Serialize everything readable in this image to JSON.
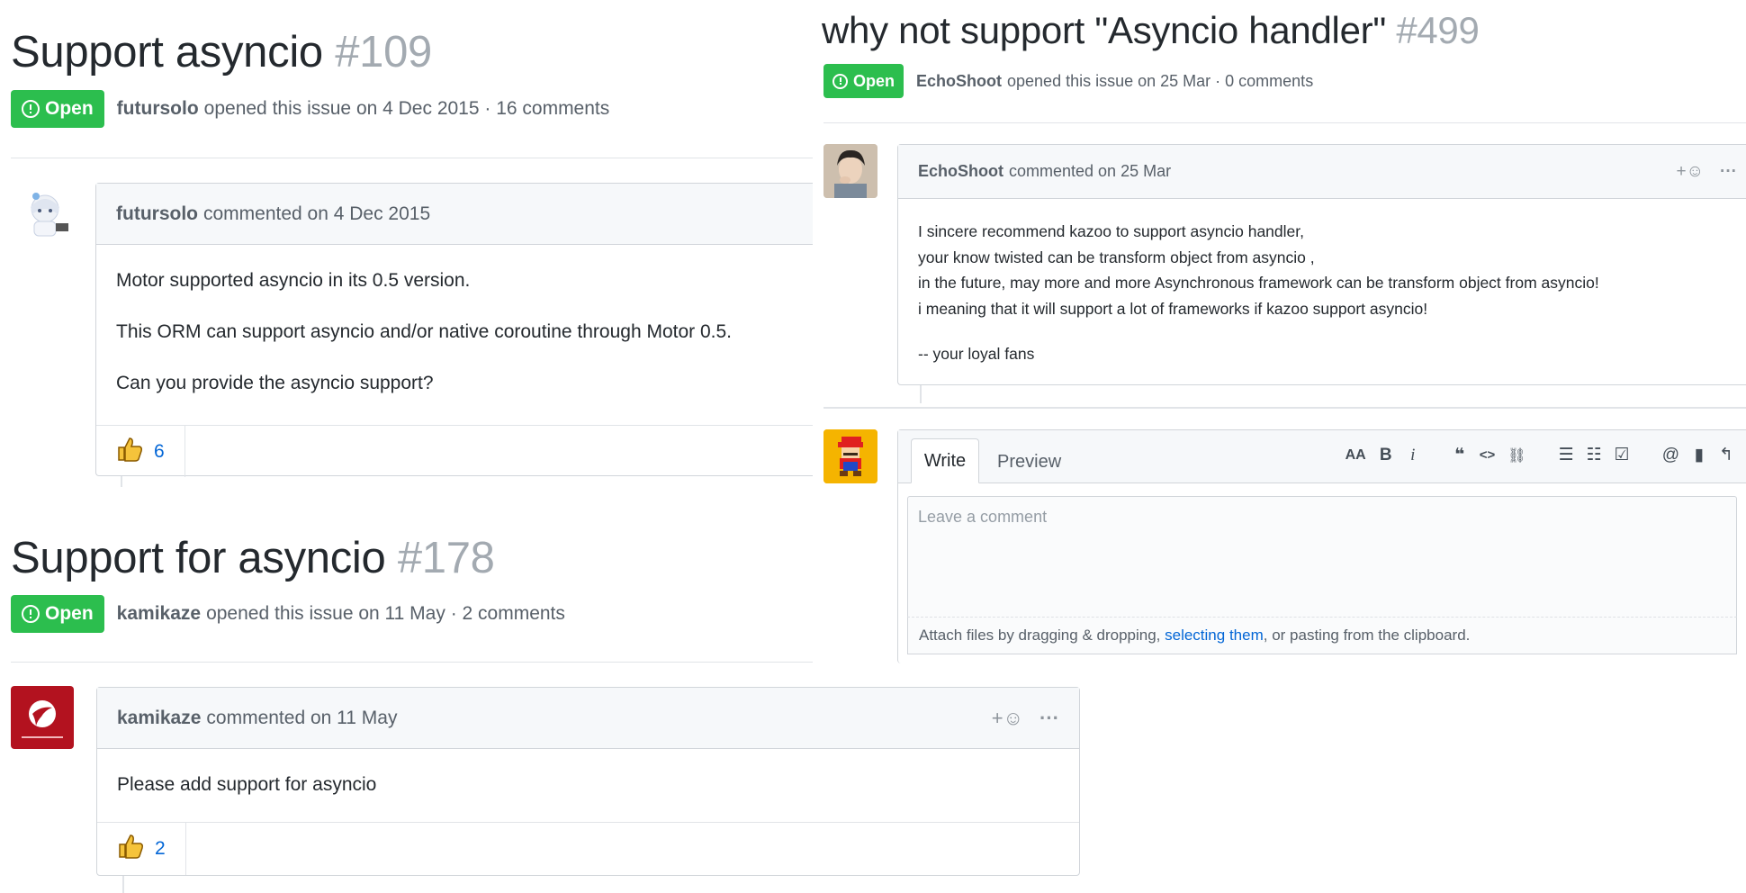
{
  "issue109": {
    "title": "Support asyncio",
    "number": "#109",
    "status": "Open",
    "author": "futursolo",
    "meta": "opened this issue on 4 Dec 2015 · 16 comments",
    "comment": {
      "author": "futursolo",
      "when": "commented on 4 Dec 2015",
      "lines": [
        "Motor supported asyncio in its 0.5 version.",
        "This ORM can support asyncio and/or native coroutine through Motor 0.5.",
        "Can you provide the asyncio support?"
      ],
      "thumbs_up": "6"
    }
  },
  "issue178": {
    "title": "Support for asyncio",
    "number": "#178",
    "status": "Open",
    "author": "kamikaze",
    "meta": "opened this issue on 11 May · 2 comments",
    "comment": {
      "author": "kamikaze",
      "when": "commented on 11 May",
      "add_reaction": "+☺",
      "more": "···",
      "lines": [
        "Please add support for asyncio"
      ],
      "thumbs_up": "2"
    }
  },
  "issue499": {
    "title": "why not support \"Asyncio handler\"",
    "number": "#499",
    "status": "Open",
    "author": "EchoShoot",
    "meta": "opened this issue on 25 Mar · 0 comments",
    "comment": {
      "author": "EchoShoot",
      "when": "commented on 25 Mar",
      "add_reaction": "+☺",
      "more": "···",
      "lines": [
        "I sincere recommend kazoo to support asyncio handler,",
        "your know twisted can be transform object from asyncio ,",
        "in the future, may more and more Asynchronous framework can be transform object from asyncio!",
        "i meaning that it will support a lot of frameworks if kazoo support asyncio!",
        "-- your loyal fans"
      ]
    },
    "editor": {
      "tab_write": "Write",
      "tab_preview": "Preview",
      "placeholder": "Leave a comment",
      "attach_prefix": "Attach files by dragging & dropping, ",
      "attach_link": "selecting them",
      "attach_suffix": ", or pasting from the clipboard.",
      "toolbar": {
        "text_size": "AA",
        "bold": "B",
        "italic": "i",
        "quote": "❝",
        "code": "<>",
        "link": "⛓",
        "bulleted": "☰",
        "numbered": "☷",
        "tasks": "☑",
        "mention": "@",
        "saved": "▮",
        "reply": "↰"
      }
    }
  },
  "colors": {
    "open_green": "#2cbe4e",
    "link_blue": "#0366d6",
    "number_gray": "#a3aab1"
  },
  "icons": [
    "open-issue-icon",
    "thumbs-up-icon",
    "add-reaction-icon",
    "more-icon"
  ]
}
